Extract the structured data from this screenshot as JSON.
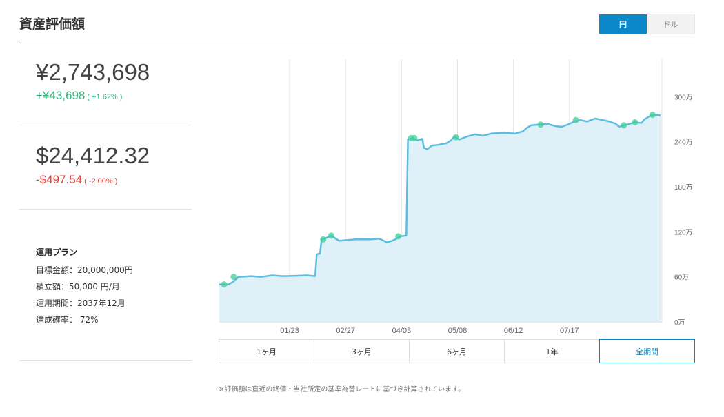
{
  "header": {
    "title": "資産評価額"
  },
  "currency_toggle": {
    "options": [
      "円",
      "ドル"
    ],
    "selected": "円"
  },
  "summary_jpy": {
    "value": "¥2,743,698",
    "change": "+¥43,698",
    "change_pct": "( +1.62% )"
  },
  "summary_usd": {
    "value": "$24,412.32",
    "change": "-$497.54",
    "change_pct": "( -2.00% )"
  },
  "plan": {
    "title": "運用プラン",
    "lines": [
      "目標金額：20,000,000円",
      "積立額：50,000 円/月",
      "運用期間：2037年12月",
      "達成確率：  72%"
    ]
  },
  "range_tabs": {
    "options": [
      "1ヶ月",
      "3ヶ月",
      "6ヶ月",
      "1年",
      "全期間"
    ],
    "selected": "全期間"
  },
  "footnote": "※評価額は直近の終値・当社所定の基準為替レートに基づき計算されています。",
  "colors": {
    "accent": "#0a88c8",
    "line": "#5bbde0",
    "area": "#dff0f8",
    "marker": "#3fcf9a",
    "positive": "#2db57e",
    "negative": "#e0413c"
  },
  "chart_data": {
    "type": "area",
    "x_tick_labels": [
      "01/23",
      "02/27",
      "04/03",
      "05/08",
      "06/12",
      "07/17"
    ],
    "y_tick_labels": [
      "0万",
      "60万",
      "120万",
      "180万",
      "240万",
      "300万"
    ],
    "ylim": [
      0,
      3500000
    ],
    "series": [
      {
        "values": [
          [
            0,
            500000
          ],
          [
            6,
            500000
          ],
          [
            9,
            540000
          ],
          [
            12,
            600000
          ],
          [
            20,
            610000
          ],
          [
            26,
            600000
          ],
          [
            33,
            620000
          ],
          [
            40,
            610000
          ],
          [
            48,
            615000
          ],
          [
            55,
            620000
          ],
          [
            60,
            610000
          ],
          [
            61,
            900000
          ],
          [
            63,
            910000
          ],
          [
            64,
            1100000
          ],
          [
            67,
            1120000
          ],
          [
            70,
            1150000
          ],
          [
            75,
            1080000
          ],
          [
            85,
            1100000
          ],
          [
            95,
            1100000
          ],
          [
            100,
            1110000
          ],
          [
            105,
            1060000
          ],
          [
            108,
            1080000
          ],
          [
            110,
            1100000
          ],
          [
            113,
            1140000
          ],
          [
            117,
            1150000
          ],
          [
            118,
            2430000
          ],
          [
            121,
            2450000
          ],
          [
            124,
            2420000
          ],
          [
            127,
            2440000
          ],
          [
            128,
            2320000
          ],
          [
            130,
            2300000
          ],
          [
            133,
            2350000
          ],
          [
            137,
            2360000
          ],
          [
            142,
            2380000
          ],
          [
            145,
            2420000
          ],
          [
            147,
            2470000
          ],
          [
            150,
            2430000
          ],
          [
            155,
            2470000
          ],
          [
            160,
            2500000
          ],
          [
            165,
            2480000
          ],
          [
            170,
            2510000
          ],
          [
            178,
            2520000
          ],
          [
            185,
            2510000
          ],
          [
            190,
            2540000
          ],
          [
            192,
            2580000
          ],
          [
            195,
            2620000
          ],
          [
            200,
            2630000
          ],
          [
            205,
            2640000
          ],
          [
            210,
            2610000
          ],
          [
            214,
            2600000
          ],
          [
            218,
            2630000
          ],
          [
            222,
            2670000
          ],
          [
            226,
            2690000
          ],
          [
            230,
            2670000
          ],
          [
            235,
            2710000
          ],
          [
            240,
            2690000
          ],
          [
            244,
            2670000
          ],
          [
            248,
            2640000
          ],
          [
            250,
            2600000
          ],
          [
            253,
            2620000
          ],
          [
            257,
            2640000
          ],
          [
            260,
            2660000
          ],
          [
            264,
            2650000
          ],
          [
            266,
            2700000
          ],
          [
            270,
            2750000
          ],
          [
            274,
            2760000
          ],
          [
            276,
            2750000
          ]
        ],
        "markers": [
          [
            3,
            500000
          ],
          [
            9,
            600000
          ],
          [
            65,
            1100000
          ],
          [
            70,
            1150000
          ],
          [
            112,
            1140000
          ],
          [
            120,
            2450000
          ],
          [
            122,
            2450000
          ],
          [
            148,
            2460000
          ],
          [
            201,
            2630000
          ],
          [
            223,
            2690000
          ],
          [
            253,
            2620000
          ],
          [
            260,
            2660000
          ],
          [
            271,
            2760000
          ]
        ]
      }
    ],
    "x_ticks_at_day": [
      44,
      79,
      114,
      149,
      184,
      219
    ]
  }
}
